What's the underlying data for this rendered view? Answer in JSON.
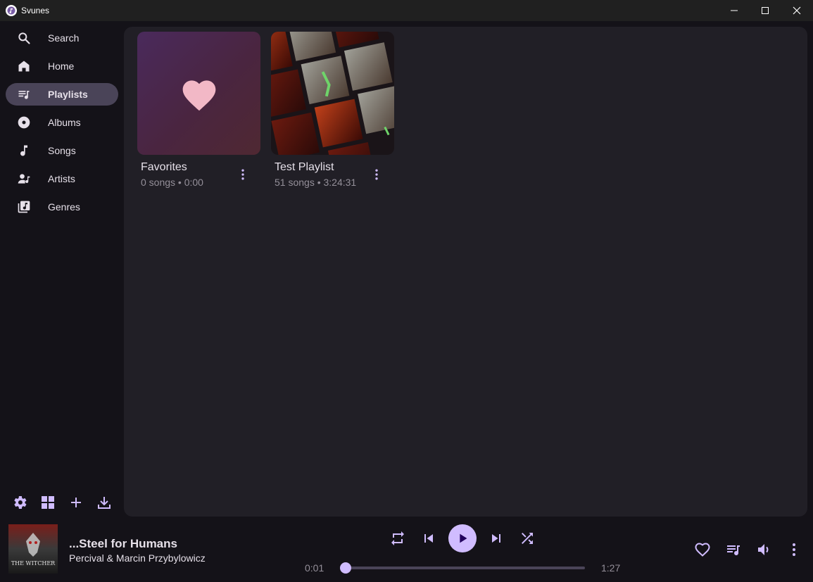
{
  "window": {
    "title": "Svunes"
  },
  "sidebar": {
    "items": [
      {
        "label": "Search",
        "icon": "search-icon"
      },
      {
        "label": "Home",
        "icon": "home-icon"
      },
      {
        "label": "Playlists",
        "icon": "playlist-icon",
        "active": true
      },
      {
        "label": "Albums",
        "icon": "album-icon"
      },
      {
        "label": "Songs",
        "icon": "music-note-icon"
      },
      {
        "label": "Artists",
        "icon": "artist-icon"
      },
      {
        "label": "Genres",
        "icon": "genre-icon"
      }
    ],
    "actions": [
      "settings-icon",
      "grid-icon",
      "add-icon",
      "download-icon"
    ]
  },
  "playlists": [
    {
      "title": "Favorites",
      "subtitle": "0 songs • 0:00"
    },
    {
      "title": "Test Playlist",
      "subtitle": "51 songs • 3:24:31"
    }
  ],
  "player": {
    "track_title": "...Steel for Humans",
    "track_artist": "Percival & Marcin Przybylowicz",
    "elapsed": "0:01",
    "duration": "1:27",
    "progress": 0.012,
    "album_art_text": "THE WITCHER",
    "accent_color": "#d0bcff"
  }
}
